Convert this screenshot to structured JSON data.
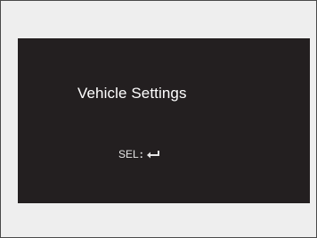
{
  "screen": {
    "title": "Vehicle Settings",
    "hint": {
      "label": "SEL",
      "separator": ":",
      "icon": "enter-arrow-icon"
    }
  },
  "colors": {
    "frame_background": "#eeeeee",
    "screen_background": "#231f20",
    "text": "#ffffff"
  }
}
